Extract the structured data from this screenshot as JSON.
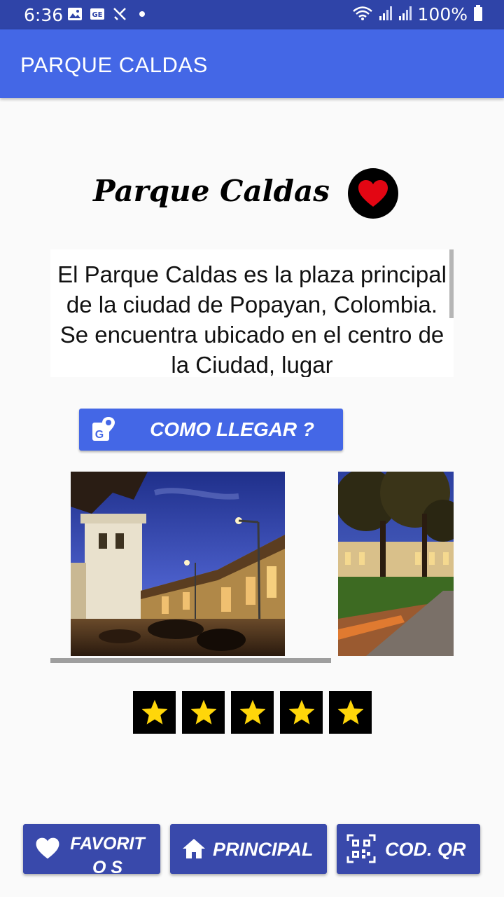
{
  "status_bar": {
    "time": "6:36",
    "battery": "100%",
    "icons": [
      "image-icon",
      "ge-icon",
      "missed-call-icon",
      "dot-icon",
      "wifi-icon",
      "signal-icon",
      "signal-icon",
      "battery-icon"
    ]
  },
  "app_bar": {
    "title": "PARQUE CALDAS"
  },
  "place": {
    "title": "Parque Caldas",
    "description": "El Parque Caldas es la plaza principal de la ciudad de Popayan, Colombia. Se encuentra ubicado en el centro de la Ciudad, lugar",
    "favorite_icon": "heart-icon"
  },
  "route_button": {
    "label": "COMO LLEGAR ?",
    "icon": "maps-icon"
  },
  "rating": {
    "value": 5,
    "max": 5,
    "star_color": "#ffd60a"
  },
  "bottom_nav": {
    "favorites": "FAVORITO S",
    "home": "PRINCIPAL",
    "qr": "COD. QR"
  },
  "colors": {
    "status_bar": "#2f44a8",
    "app_bar": "#4467e6",
    "button": "#4467e6",
    "nav_button": "#3949ab",
    "heart": "#e30613"
  }
}
